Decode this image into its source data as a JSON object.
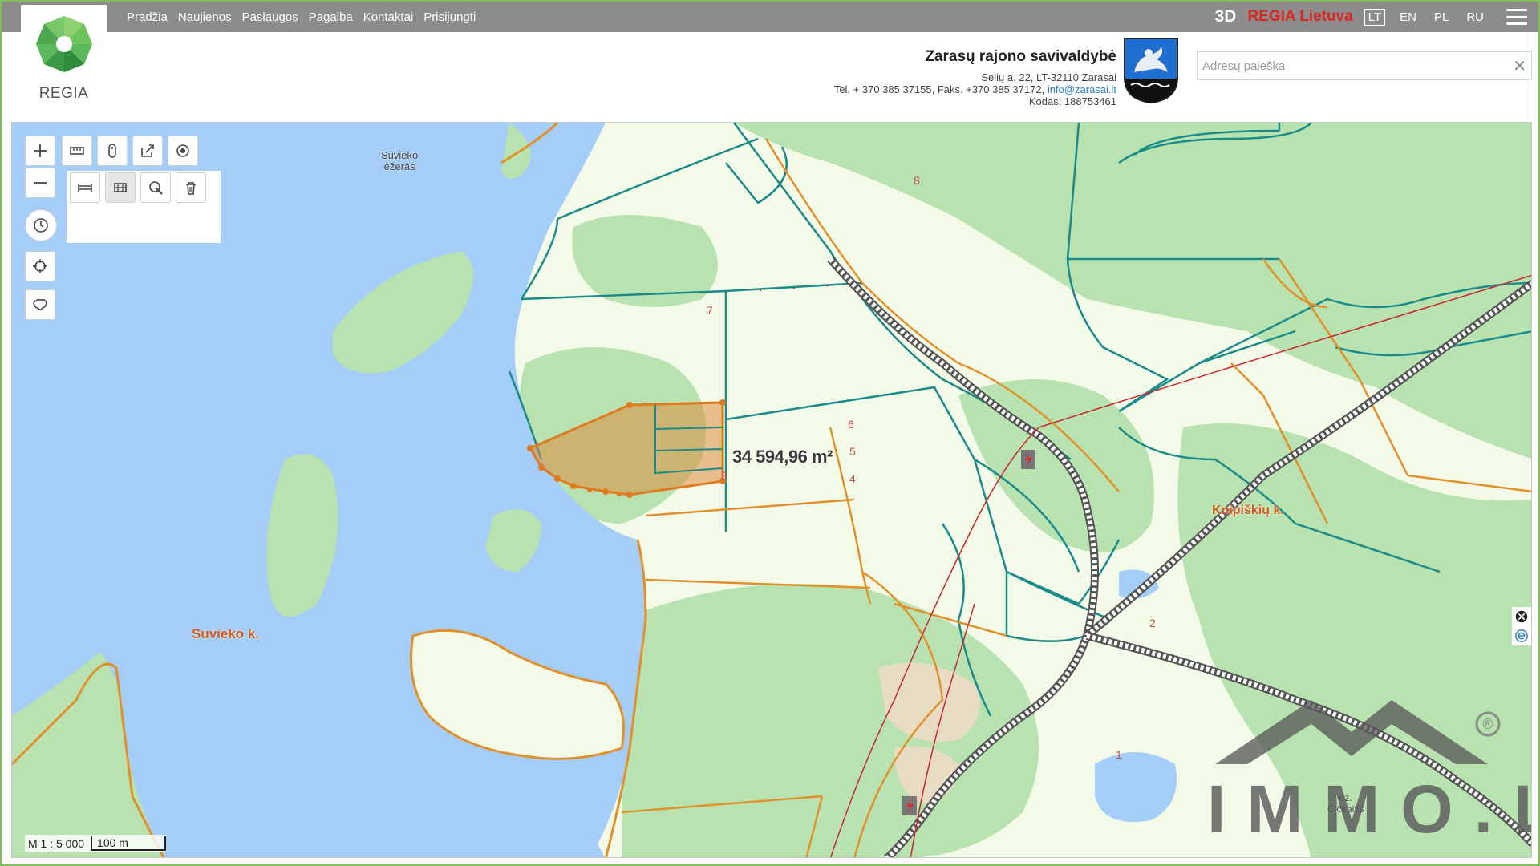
{
  "nav": [
    "Pradžia",
    "Naujienos",
    "Paslaugos",
    "Pagalba",
    "Kontaktai",
    "Prisijungti"
  ],
  "logo": {
    "text": "REGIA"
  },
  "top_right": {
    "mode_3d": "3D",
    "brand": "REGIA Lietuva",
    "languages": [
      "LT",
      "EN",
      "PL",
      "RU"
    ],
    "active_language": "LT"
  },
  "municipality": {
    "name": "Zarasų rajono savivaldybė",
    "address": "Sėlių a. 22, LT-32110 Zarasai",
    "phone": "Tel. + 370 385 37155, Faks. +370 385 37172,",
    "email": "info@zarasai.lt",
    "code": "Kodas: 188753461"
  },
  "search": {
    "placeholder": "Adresų paieška",
    "clear": "✕"
  },
  "map": {
    "lake_label_1": "Suvieko",
    "lake_label_2": "ežeras",
    "village_1": "Suvieko k.",
    "village_2": "Knipiškių k.",
    "small_lake": "Čičiraitis",
    "small_lake_prefix": "ež.",
    "area_measurement": "34 594,96 m²",
    "parcel_numbers": [
      "8",
      "7",
      "6",
      "5",
      "4",
      "3",
      "2",
      "1"
    ],
    "scale_ratio": "M 1 : 5 000",
    "scale_bar": "100 m"
  },
  "watermark": {
    "text": "IMMO.LT",
    "registered": "®"
  },
  "colors": {
    "water": "#a4cdf7",
    "forest": "#b8e3b0",
    "field": "#f4fae8",
    "parcel_border": "#1a8a8a",
    "selection": "#e07a1f",
    "road": "#e2902a"
  }
}
